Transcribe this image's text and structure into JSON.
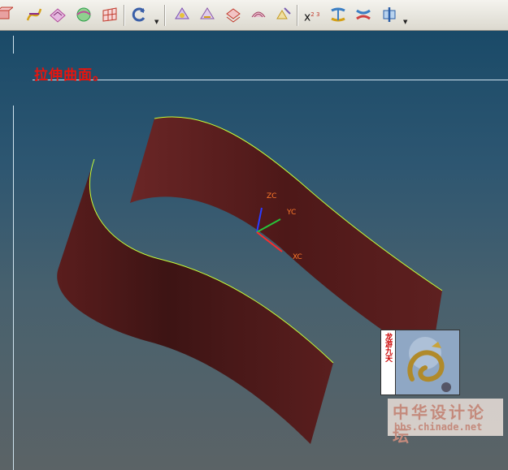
{
  "toolbar": {
    "buttons": [
      {
        "name": "extrude-icon",
        "color": "#c0392b"
      },
      {
        "name": "curve-icon",
        "color": "#d4a017"
      },
      {
        "name": "ruled-surface-icon",
        "color": "#b04a9a"
      },
      {
        "name": "sphere-surface-icon",
        "color": "#2e9e4a"
      },
      {
        "name": "mesh-surface-icon",
        "color": "#c0392b"
      },
      {
        "name": "rotate-icon",
        "color": "#3a5fa8"
      },
      {
        "name": "face-blend-icon",
        "color": "#7b4fb0"
      },
      {
        "name": "face-edit-icon",
        "color": "#8a5aa8"
      },
      {
        "name": "offset-surface-icon",
        "color": "#c0392b"
      },
      {
        "name": "trim-surface-icon",
        "color": "#a04060"
      },
      {
        "name": "sew-surface-icon",
        "color": "#c49a1f"
      },
      {
        "name": "power-formula-icon",
        "color": "#111111"
      },
      {
        "name": "bridge-curve-icon",
        "color": "#3c7fc4"
      },
      {
        "name": "blend-curve-icon",
        "color": "#d04040"
      },
      {
        "name": "center-align-icon",
        "color": "#2c5fa8"
      }
    ],
    "power_label": "x",
    "power_exp": "2 3"
  },
  "viewport": {
    "caption": "拉伸曲面。",
    "axes": {
      "zc": "ZC",
      "yc": "YC",
      "xc": "XC"
    },
    "surface_color": "#5a1e1e",
    "edge_color": "#c6ff3a"
  },
  "badge": {
    "text": "龙游九天"
  },
  "watermark": {
    "title": "中华设计论坛",
    "url": "bbs.chinade.net"
  }
}
